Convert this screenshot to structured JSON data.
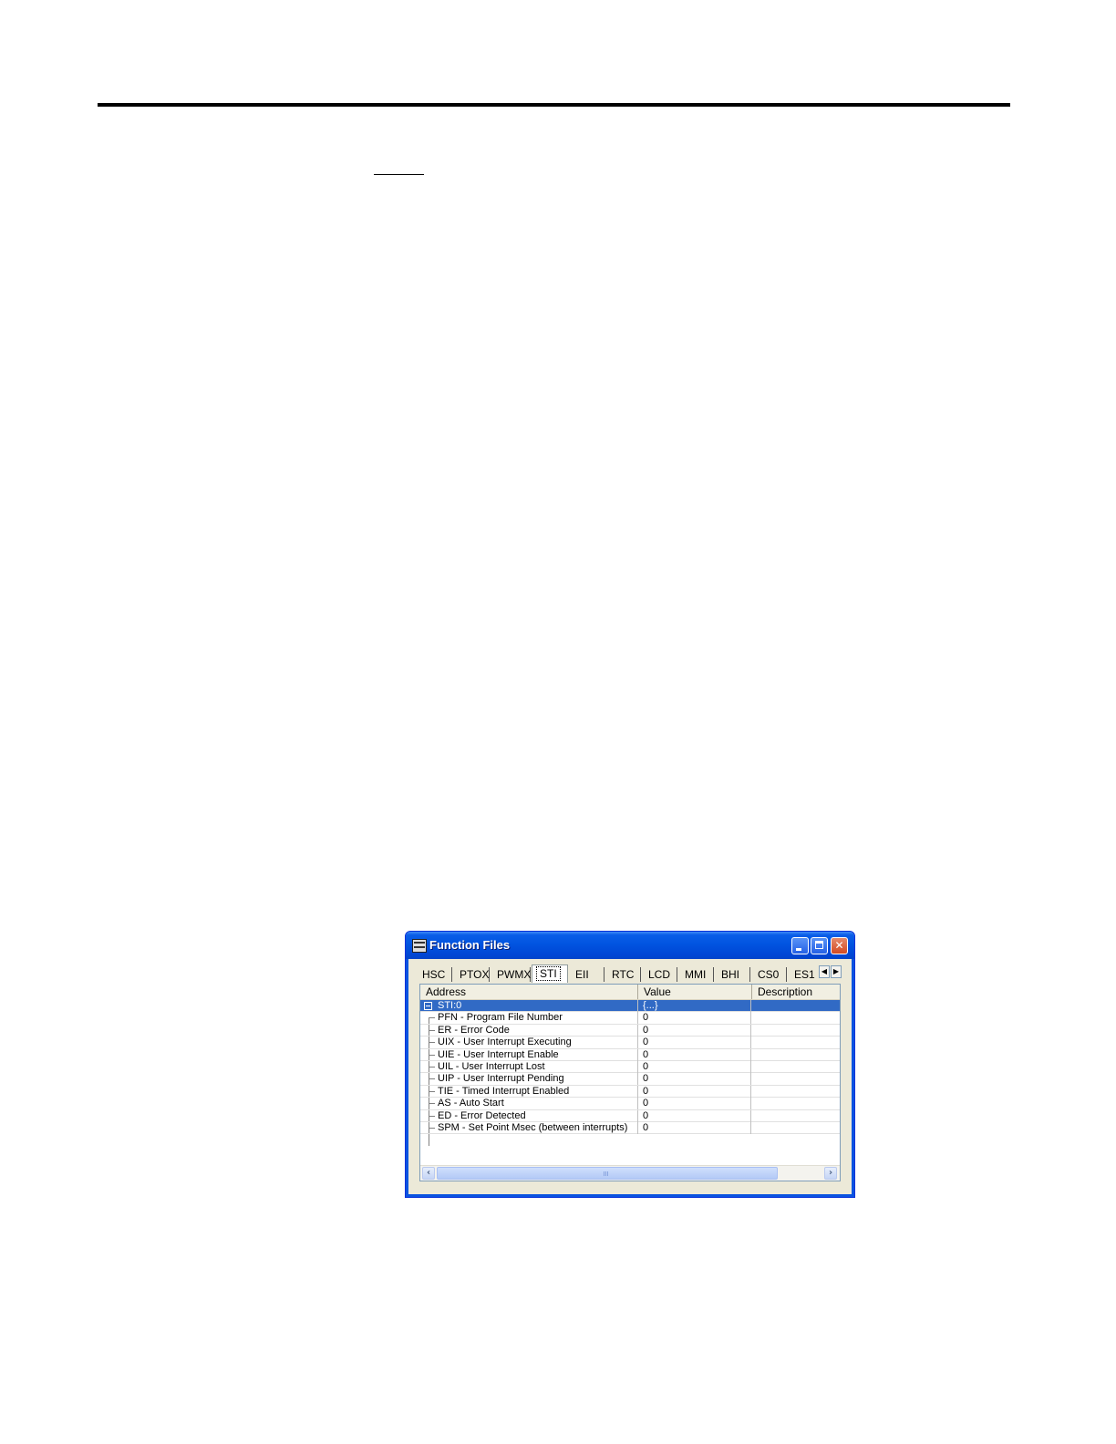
{
  "window": {
    "title": "Function Files",
    "controls": {
      "minimize": "_",
      "maximize": "□",
      "close": "✕"
    }
  },
  "tabs": [
    "HSC",
    "PTOX",
    "PWMX",
    "STI",
    "EII",
    "RTC",
    "LCD",
    "MMI",
    "BHI",
    "CS0",
    "ES1"
  ],
  "active_tab": "STI",
  "tab_scroll": {
    "left": "◀",
    "right": "▶"
  },
  "grid": {
    "columns": [
      "Address",
      "Value",
      "Description"
    ],
    "rows": [
      {
        "address": "STI:0",
        "value": "{...}",
        "description": ""
      },
      {
        "address": "PFN - Program File Number",
        "value": "0",
        "description": ""
      },
      {
        "address": "ER - Error Code",
        "value": "0",
        "description": ""
      },
      {
        "address": "UIX - User Interrupt Executing",
        "value": "0",
        "description": ""
      },
      {
        "address": "UIE - User Interrupt Enable",
        "value": "0",
        "description": ""
      },
      {
        "address": "UIL - User Interrupt Lost",
        "value": "0",
        "description": ""
      },
      {
        "address": "UIP - User Interrupt Pending",
        "value": "0",
        "description": ""
      },
      {
        "address": "TIE - Timed Interrupt Enabled",
        "value": "0",
        "description": ""
      },
      {
        "address": "AS - Auto Start",
        "value": "0",
        "description": ""
      },
      {
        "address": "ED - Error Detected",
        "value": "0",
        "description": ""
      },
      {
        "address": "SPM - Set Point Msec (between interrupts)",
        "value": "0",
        "description": ""
      }
    ]
  },
  "scrollbar": {
    "left": "‹",
    "right": "›"
  },
  "colors": {
    "selection": "#316ac5",
    "titlebar": "#0054e3",
    "window_face": "#ece9d8"
  }
}
